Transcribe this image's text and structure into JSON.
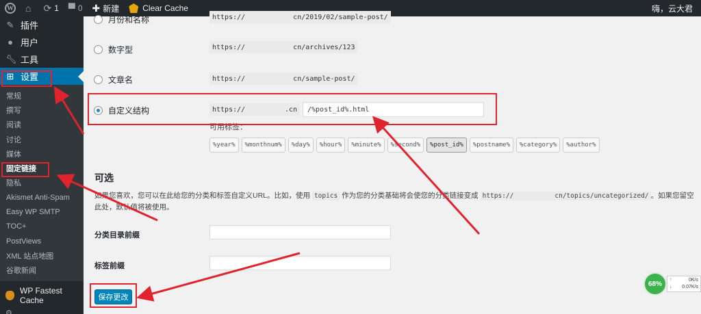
{
  "adminbar": {
    "updates_count": "1",
    "comments_count": "0",
    "new_label": "新建",
    "clear_cache_label": "Clear Cache",
    "greeting": "嗨，云大君"
  },
  "sidebar": {
    "top_items": [
      {
        "label": "插件"
      },
      {
        "label": "用户"
      },
      {
        "label": "工具"
      },
      {
        "label": "设置"
      }
    ],
    "sub_items": [
      {
        "label": "常规"
      },
      {
        "label": "撰写"
      },
      {
        "label": "阅读"
      },
      {
        "label": "讨论"
      },
      {
        "label": "媒体"
      },
      {
        "label": "固定链接"
      },
      {
        "label": "隐私"
      },
      {
        "label": "Akismet Anti-Spam"
      },
      {
        "label": "Easy WP SMTP"
      },
      {
        "label": "TOC+"
      },
      {
        "label": "PostViews"
      },
      {
        "label": "XML 站点地图"
      },
      {
        "label": "谷歌新闻"
      }
    ],
    "plugin": {
      "label": "WP Fastest Cache"
    }
  },
  "permalinks": {
    "options": [
      {
        "label": "月份和名称",
        "url_start": "https://",
        "url_end": "cn/2019/02/sample-post/",
        "checked": false
      },
      {
        "label": "数字型",
        "url_start": "https://",
        "url_end": "cn/archives/123",
        "checked": false
      },
      {
        "label": "文章名",
        "url_start": "https://",
        "url_end": "cn/sample-post/",
        "checked": false
      },
      {
        "label": "自定义结构",
        "url_start": "https://",
        "url_end": ".cn",
        "checked": true
      }
    ],
    "custom_structure_value": "/%post_id%.html",
    "available_tags_label": "可用标签：",
    "tags": [
      "%year%",
      "%monthnum%",
      "%day%",
      "%hour%",
      "%minute%",
      "%second%",
      "%post_id%",
      "%postname%",
      "%category%",
      "%author%"
    ],
    "active_tag": "%post_id%"
  },
  "optional": {
    "title": "可选",
    "description_part1": "如果您喜欢，您可以在此给您的分类和标签自定义URL。比如，使用",
    "description_code": "topics",
    "description_part2": "作为您的分类基础将会使您的分类链接变成",
    "description_url_start": "https://",
    "description_url_end": "cn/topics/uncategorized/",
    "description_part3": "。如果您留空此处，默认值将被使用。",
    "category_base_label": "分类目录前缀",
    "category_base_value": "",
    "tag_base_label": "标签前缀",
    "tag_base_value": ""
  },
  "save_button_label": "保存更改",
  "speed_widget": {
    "percent": "68%",
    "upload": "0K/s",
    "download": "0.07K/s"
  },
  "colors": {
    "admin_dark": "#23282d",
    "accent_blue": "#0073aa",
    "annotation_red": "#e0232c"
  }
}
